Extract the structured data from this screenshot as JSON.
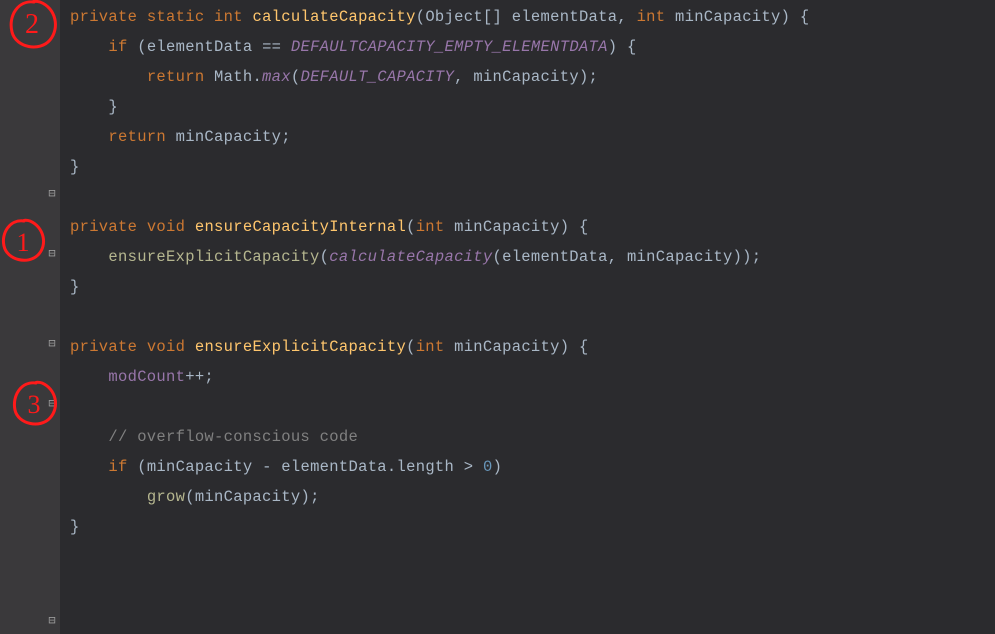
{
  "annotations": {
    "a1": "1",
    "a2": "2",
    "a3": "3"
  },
  "code": {
    "l0": {
      "kw1": "private",
      "kw2": "static",
      "kw3": "int",
      "name": "calculateCapacity",
      "p1t": "Object",
      "p1b": "[]",
      "p1n": "elementData",
      "p2t": "int",
      "p2n": "minCapacity"
    },
    "l1": {
      "kw": "if",
      "lhs": "elementData",
      "op": "==",
      "rhs": "DEFAULTCAPACITY_EMPTY_ELEMENTDATA"
    },
    "l2": {
      "kw": "return",
      "cls": "Math",
      "dot": ".",
      "m": "max",
      "a1": "DEFAULT_CAPACITY",
      "a2": "minCapacity"
    },
    "l3": {
      "brace": "}"
    },
    "l4": {
      "kw": "return",
      "v": "minCapacity"
    },
    "l5": {
      "brace": "}"
    },
    "l6": {
      "kw1": "private",
      "kw2": "void",
      "name": "ensureCapacityInternal",
      "p1t": "int",
      "p1n": "minCapacity"
    },
    "l7": {
      "m1": "ensureExplicitCapacity",
      "m2": "calculateCapacity",
      "a1": "elementData",
      "a2": "minCapacity"
    },
    "l8": {
      "brace": "}"
    },
    "l9": {
      "kw1": "private",
      "kw2": "void",
      "name": "ensureExplicitCapacity",
      "p1t": "int",
      "p1n": "minCapacity"
    },
    "l10": {
      "f": "modCount",
      "op": "++"
    },
    "l11": {
      "c": "// overflow-conscious code"
    },
    "l12": {
      "kw": "if",
      "a": "minCapacity",
      "op1": "-",
      "b": "elementData",
      "dot": ".",
      "prop": "length",
      "op2": ">",
      "n": "0"
    },
    "l13": {
      "m": "grow",
      "a": "minCapacity"
    },
    "l14": {
      "brace": "}"
    }
  },
  "colors": {
    "annotation": "#ff1a1a"
  }
}
